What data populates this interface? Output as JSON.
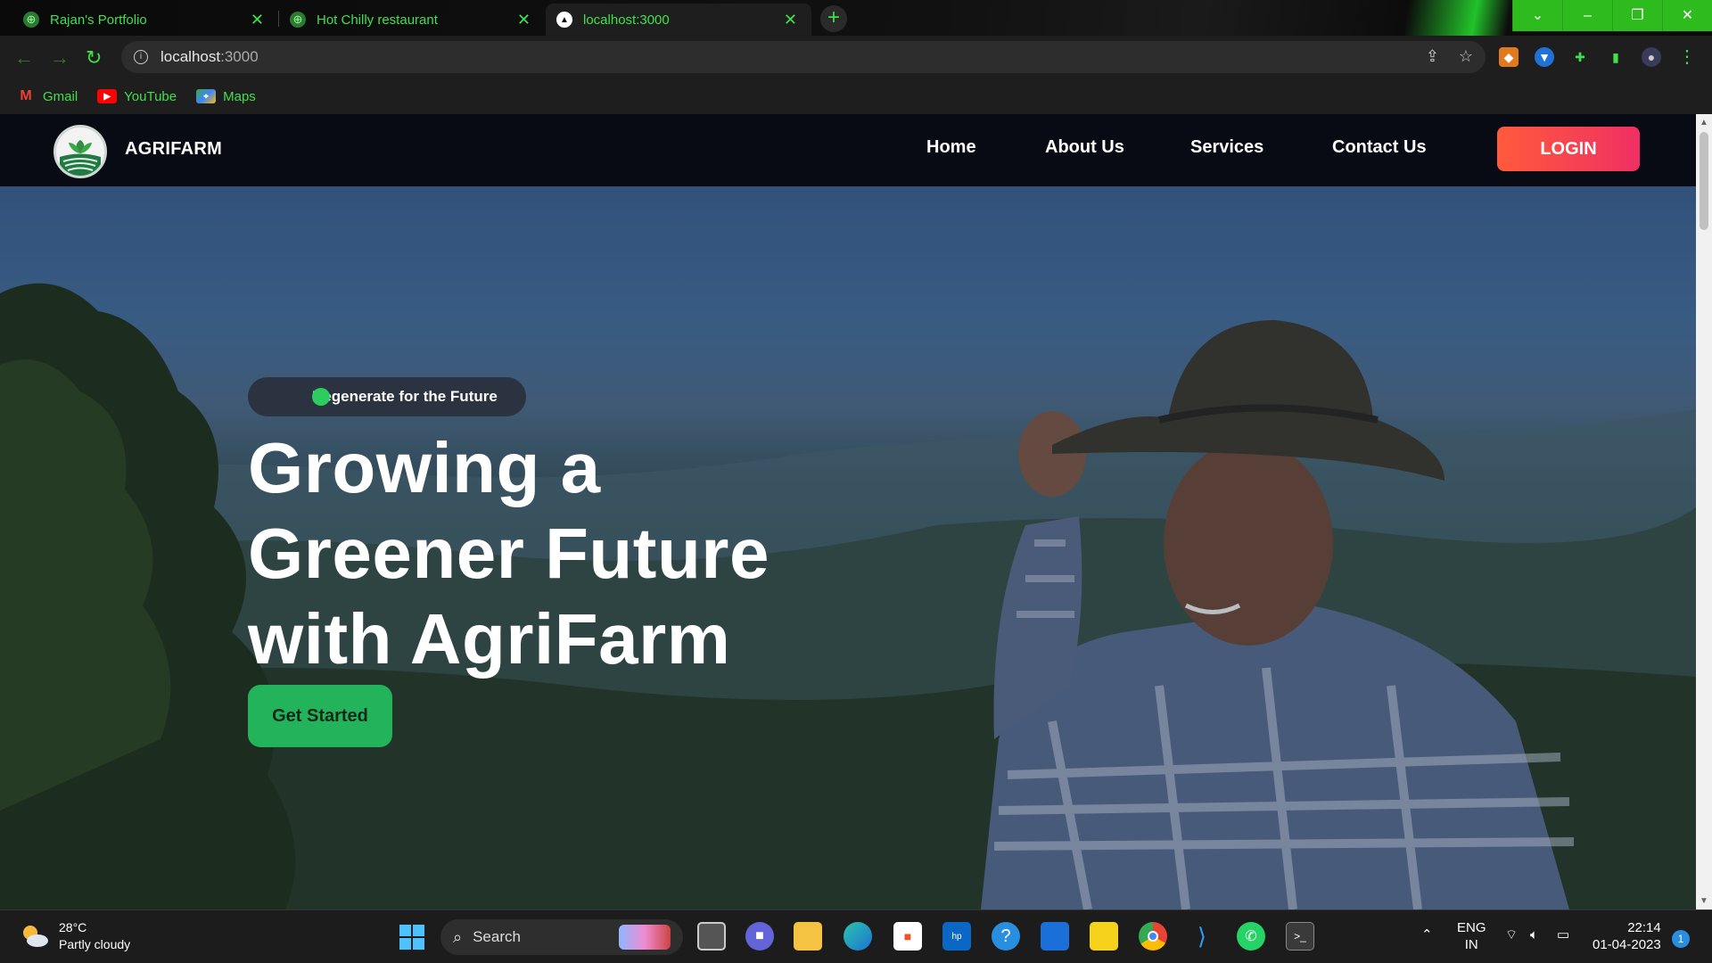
{
  "browser": {
    "tabs": [
      {
        "title": "Rajan's Portfolio",
        "active": false
      },
      {
        "title": "Hot Chilly restaurant",
        "active": false
      },
      {
        "title": "localhost:3000",
        "active": true
      }
    ],
    "url_host": "localhost",
    "url_port": ":3000",
    "bookmarks": [
      {
        "label": "Gmail",
        "icon": "gmail-icon"
      },
      {
        "label": "YouTube",
        "icon": "youtube-icon"
      },
      {
        "label": "Maps",
        "icon": "maps-icon"
      }
    ],
    "accent": "#3fe04a"
  },
  "site": {
    "brand": "AGRIFARM",
    "nav": [
      "Home",
      "About Us",
      "Services",
      "Contact Us"
    ],
    "login": "LOGIN",
    "hero": {
      "badge": "Regenerate for the Future",
      "headline_1": "Growing a",
      "headline_2": "Greener Future",
      "headline_3": "with AgriFarm",
      "cta": "Get Started"
    },
    "colors": {
      "login": "#ff5a3c",
      "cta": "#23b35a",
      "badge_dot": "#2dcc5f"
    }
  },
  "taskbar": {
    "weather_temp": "28°C",
    "weather_desc": "Partly cloudy",
    "search": "Search",
    "lang_1": "ENG",
    "lang_2": "IN",
    "time": "22:14",
    "date": "01-04-2023",
    "notifications": "1"
  }
}
